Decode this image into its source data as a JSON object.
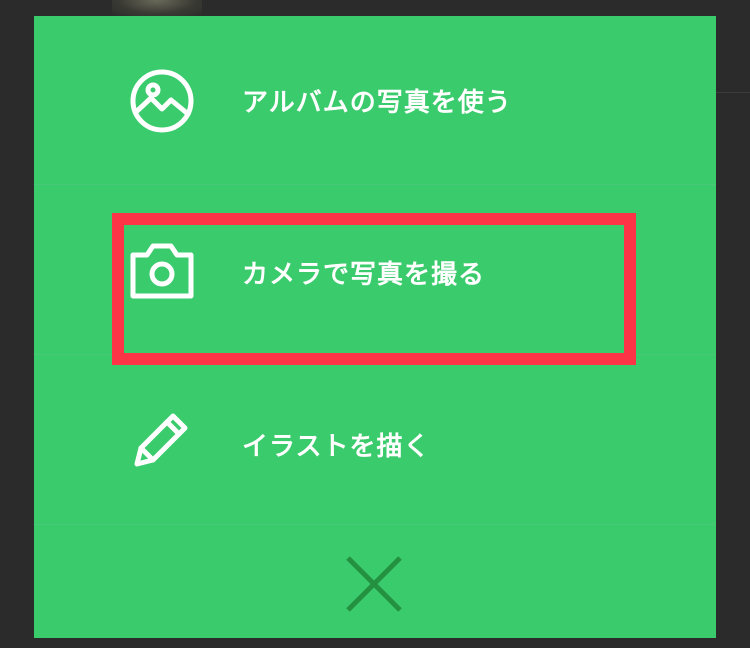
{
  "menu": {
    "items": [
      {
        "label": "アルバムの写真を使う",
        "icon": "image-icon"
      },
      {
        "label": "カメラで写真を撮る",
        "icon": "camera-icon"
      },
      {
        "label": "イラストを描く",
        "icon": "pencil-icon"
      }
    ],
    "close_icon": "close-icon"
  },
  "colors": {
    "sheet": "#3acb6c",
    "close_icon": "#23913f",
    "highlight": "#fd3346",
    "backdrop": "#2b2b2b"
  }
}
